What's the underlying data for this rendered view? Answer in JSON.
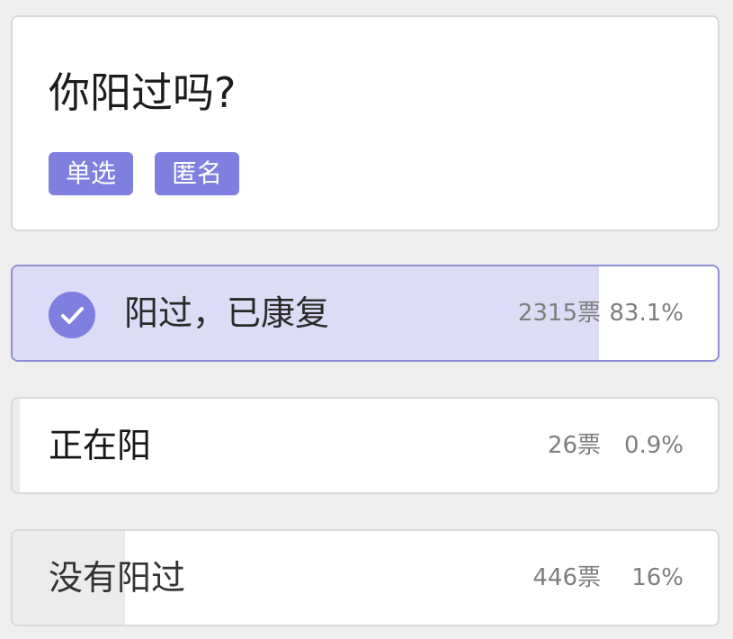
{
  "poll": {
    "question": "你阳过吗?",
    "tags": [
      "单选",
      "匿名"
    ]
  },
  "options": [
    {
      "label": "阳过，已康复",
      "votes": "2315票",
      "percent": "83.1%",
      "share": 0.831,
      "selected": true
    },
    {
      "label": "正在阳",
      "votes": "26票",
      "percent": "0.9%",
      "share": 0.009,
      "selected": false
    },
    {
      "label": "没有阳过",
      "votes": "446票",
      "percent": "16%",
      "share": 0.16,
      "selected": false
    }
  ],
  "colors": {
    "accent": "#7f7fe0",
    "selected_fill": "#dcdcf7",
    "unselected_fill": "#ececec",
    "check_icon": "check-icon"
  }
}
